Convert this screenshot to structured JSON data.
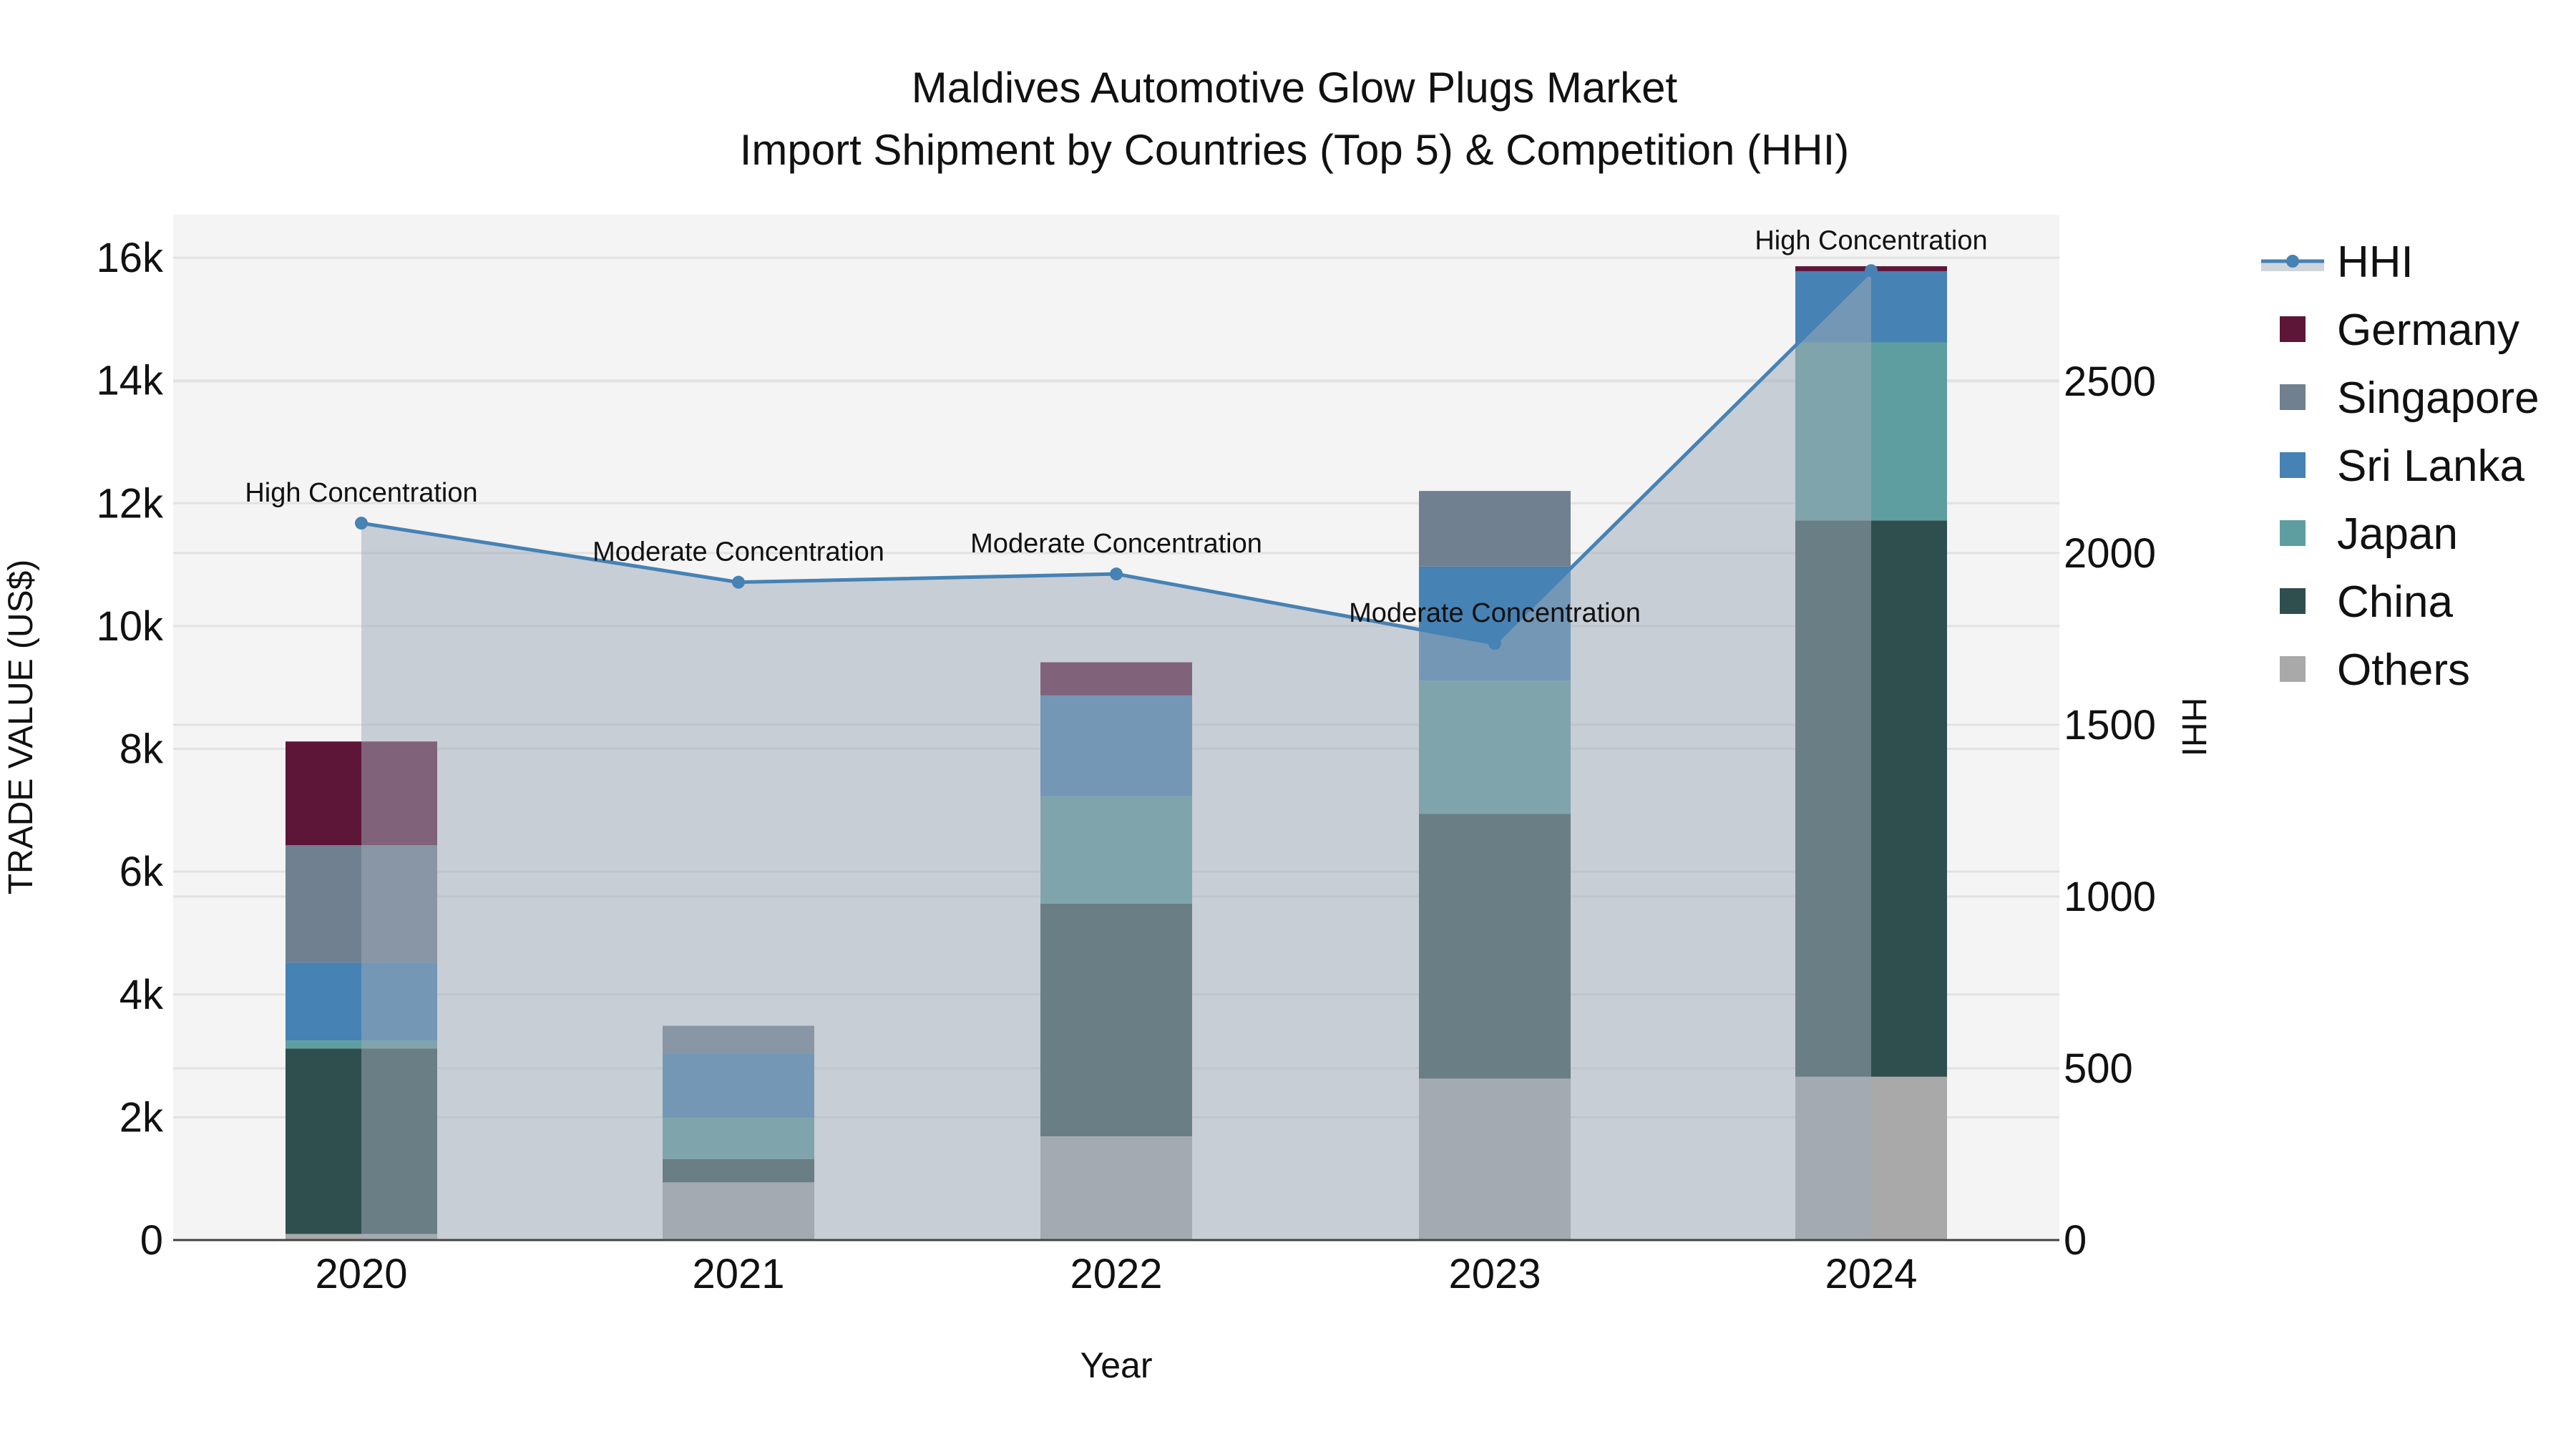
{
  "chart_data": {
    "type": "bar",
    "title": "Maldives Automotive Glow Plugs Market",
    "subtitle": "Import Shipment by Countries (Top 5) & Competition (HHI)",
    "xlabel": "Year",
    "ylabel": "TRADE VALUE (US$)",
    "y2label": "HHI",
    "categories": [
      "2020",
      "2021",
      "2022",
      "2023",
      "2024"
    ],
    "ylim": [
      0,
      16700
    ],
    "yticks": [
      0,
      2000,
      4000,
      6000,
      8000,
      10000,
      12000,
      14000,
      16000
    ],
    "ytick_labels": [
      "0",
      "2k",
      "4k",
      "6k",
      "8k",
      "10k",
      "12k",
      "14k",
      "16k"
    ],
    "y2lim": [
      0,
      2985
    ],
    "y2ticks": [
      0,
      500,
      1000,
      1500,
      2000,
      2500
    ],
    "y2tick_labels": [
      "0",
      "500",
      "1000",
      "1500",
      "2000",
      "2500"
    ],
    "stacked": true,
    "series": [
      {
        "name": "Others",
        "color": "#A9A9A9",
        "values": [
          100,
          940,
          1690,
          2630,
          2660
        ]
      },
      {
        "name": "China",
        "color": "#2F4F4F",
        "values": [
          3020,
          380,
          3790,
          4310,
          9060
        ]
      },
      {
        "name": "Japan",
        "color": "#5F9EA0",
        "values": [
          130,
          670,
          1750,
          2170,
          2900
        ]
      },
      {
        "name": "Sri Lanka",
        "color": "#4682B4",
        "values": [
          1270,
          1050,
          1640,
          1860,
          1160
        ]
      },
      {
        "name": "Singapore",
        "color": "#708090",
        "values": [
          1910,
          450,
          0,
          1230,
          0
        ]
      },
      {
        "name": "Germany",
        "color": "#5E1638",
        "values": [
          1690,
          0,
          540,
          0,
          80
        ]
      }
    ],
    "line": {
      "name": "HHI",
      "color": "#4682B4",
      "axis": "y2",
      "values": [
        2087,
        1915,
        1939,
        1737,
        2822
      ],
      "annotations": [
        "High Concentration",
        "Moderate Concentration",
        "Moderate Concentration",
        "Moderate Concentration",
        "High Concentration"
      ]
    },
    "legend": [
      "HHI",
      "Germany",
      "Singapore",
      "Sri Lanka",
      "Japan",
      "China",
      "Others"
    ],
    "legend_placement": "right",
    "grid": true
  }
}
